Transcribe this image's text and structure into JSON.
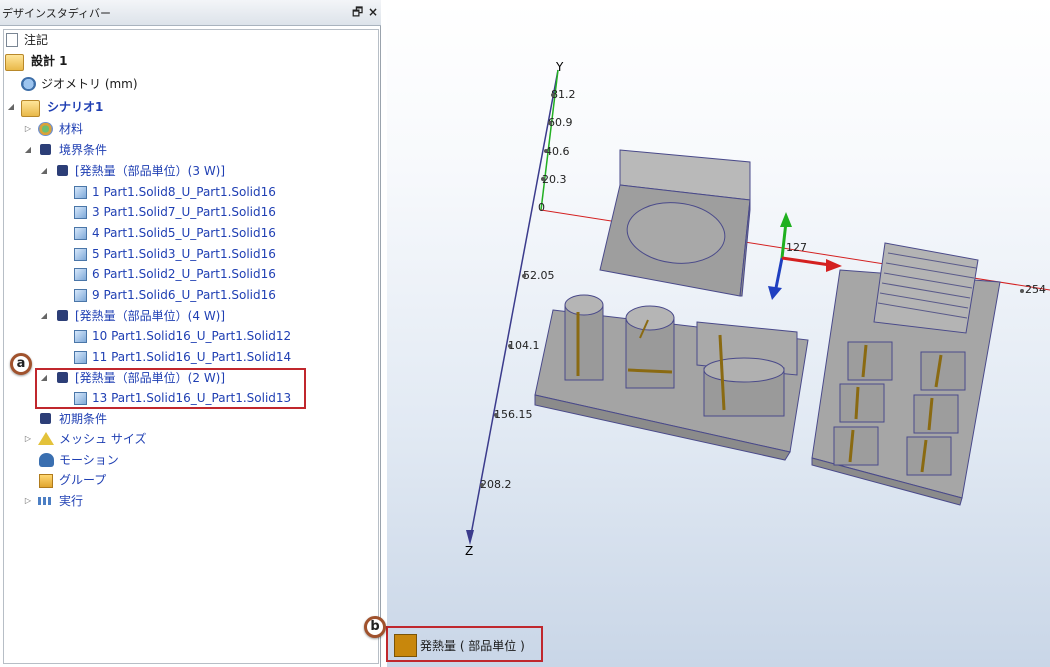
{
  "panel": {
    "title": "デザインスタディバー",
    "float_glyph": "🗗",
    "close_glyph": "×"
  },
  "tree": {
    "annotations": "注記",
    "design": "設計 1",
    "geometry": "ジオメトリ (mm)",
    "scenario": "シナリオ1",
    "materials": "材料",
    "boundary": "境界条件",
    "heat3": "[発熱量（部品単位）(3 W)]",
    "heat3_items": [
      "1 Part1.Solid8_U_Part1.Solid16",
      "3 Part1.Solid7_U_Part1.Solid16",
      "4 Part1.Solid5_U_Part1.Solid16",
      "5 Part1.Solid3_U_Part1.Solid16",
      "6 Part1.Solid2_U_Part1.Solid16",
      "9 Part1.Solid6_U_Part1.Solid16"
    ],
    "heat4": "[発熱量（部品単位）(4 W)]",
    "heat4_items": [
      "10 Part1.Solid16_U_Part1.Solid12",
      "11 Part1.Solid16_U_Part1.Solid14"
    ],
    "heat2": "[発熱量（部品単位）(2 W)]",
    "heat2_items": [
      "13 Part1.Solid16_U_Part1.Solid13"
    ],
    "initial": "初期条件",
    "mesh": "メッシュ サイズ",
    "motion": "モーション",
    "group": "グループ",
    "run": "実行"
  },
  "callouts": {
    "a": "a",
    "b": "b"
  },
  "axes": {
    "y_label": "Y",
    "z_label": "Z",
    "y_ticks": [
      "81.2",
      "60.9",
      "40.6",
      "20.3",
      "0"
    ],
    "z_ticks": [
      "52.05",
      "104.1",
      "156.15",
      "208.2"
    ],
    "x_ticks": [
      "127",
      "254"
    ]
  },
  "legend": {
    "label": "発熱量 ( 部品単位 )",
    "color": "#c8870c"
  },
  "colors": {
    "selection_red": "#c0272d",
    "tree_blue": "#1f3fb3",
    "solid_gray": "#9a9a9a"
  }
}
